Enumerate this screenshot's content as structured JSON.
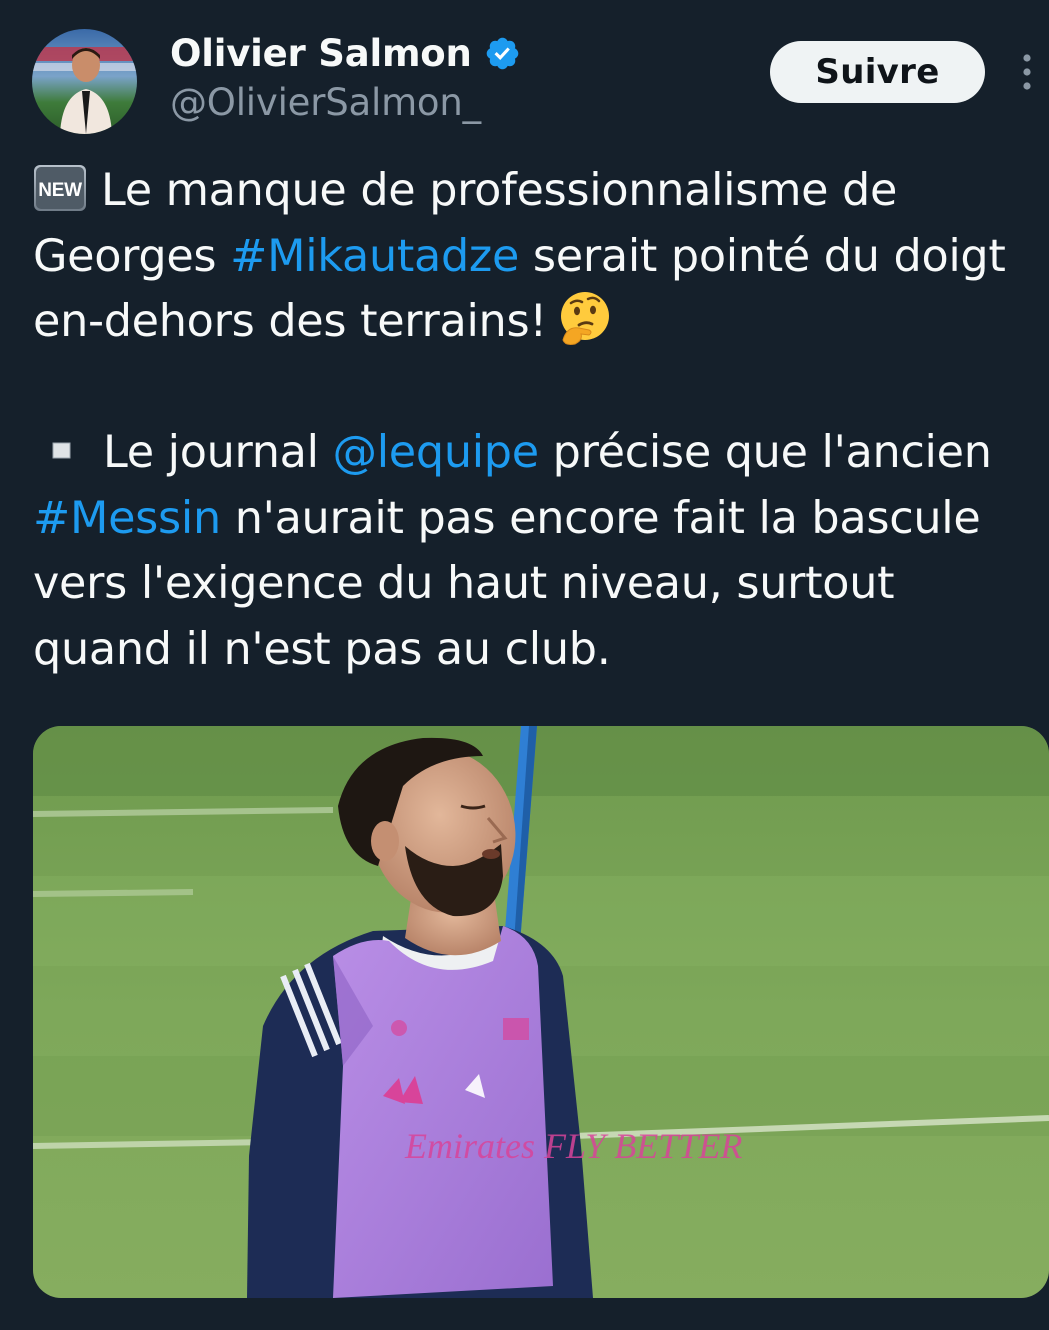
{
  "tweet": {
    "author": {
      "display_name": "Olivier Salmon",
      "handle": "@OlivierSalmon_",
      "verified": true,
      "avatar_icon": "avatar-photo"
    },
    "follow_label": "Suivre",
    "more_icon": "more-vertical-icon",
    "text": {
      "line1": {
        "badge": "NEW",
        "text": "Le manque de professionnalisme de"
      },
      "line2": {
        "before": "Georges ",
        "hashtag": "#Mikautadze",
        "after": " serait pointé du doigt"
      },
      "line3": {
        "text": "en-dehors des terrains!",
        "emoji": "thinking-face-emoji"
      },
      "line4": {
        "before": "Le journal ",
        "mention": "@lequipe",
        "after": " précise que l'ancien"
      },
      "line5": {
        "hashtag": "#Messin",
        "after": " n'aurait pas encore fait la bascule"
      },
      "line6": {
        "text": "vers l'exigence du haut niveau, surtout"
      },
      "line7": {
        "text": "quand il n'est pas au club."
      }
    },
    "media": {
      "type": "photo",
      "jersey_text": "Emirates FLY BETTER"
    }
  },
  "colors": {
    "background": "#15202b",
    "text": "#f7f9f9",
    "secondary": "#8b98a5",
    "link": "#1d9bf0",
    "follow_bg": "#eff3f4",
    "verified": "#1d9bf0"
  }
}
